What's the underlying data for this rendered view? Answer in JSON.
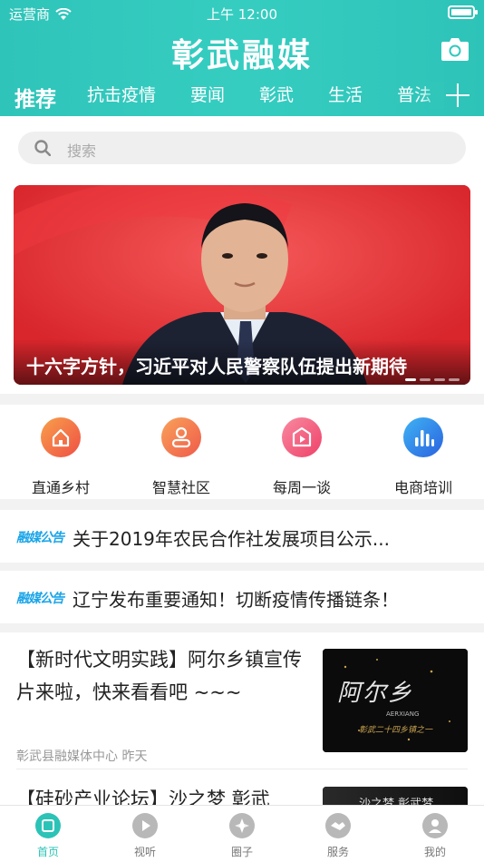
{
  "status": {
    "carrier": "运营商",
    "time": "上午 12:00"
  },
  "header": {
    "title": "彰武融媒"
  },
  "tabs": [
    {
      "label": "推荐"
    },
    {
      "label": "抗击疫情"
    },
    {
      "label": "要闻"
    },
    {
      "label": "彰武"
    },
    {
      "label": "生活"
    },
    {
      "label": "普法"
    }
  ],
  "search": {
    "placeholder": "搜索"
  },
  "banner": {
    "caption": "十六字方针，习近平对人民警察队伍提出新期待",
    "slide_count": 4,
    "active_slide": 1
  },
  "quick_links": [
    {
      "label": "直通乡村",
      "icon": "home-icon",
      "color": "#f06a46"
    },
    {
      "label": "智慧社区",
      "icon": "person-icon",
      "color": "#f27b4e"
    },
    {
      "label": "每周一谈",
      "icon": "play-icon",
      "color": "#f45d7c"
    },
    {
      "label": "电商培训",
      "icon": "bar-chart-icon",
      "color": "#2e7de8"
    }
  ],
  "notice_tag": "融媒公告",
  "notices": [
    {
      "text": "关于2019年农民合作社发展项目公示..."
    },
    {
      "text": "辽宁发布重要通知！切断疫情传播链条！"
    }
  ],
  "articles": [
    {
      "title": "【新时代文明实践】阿尔乡镇宣传片来啦，快来看看吧 ~~~",
      "source": "彰武县融媒体中心",
      "time": "昨天",
      "thumb_title": "阿尔乡",
      "thumb_sub": "AERXIANG",
      "thumb_tag": "彰武二十四乡镇之一"
    },
    {
      "title": "【硅砂产业论坛】沙之梦 彰武",
      "thumb_title": "沙之梦 彰武梦"
    }
  ],
  "tabbar": [
    {
      "label": "首页",
      "icon": "home-icon"
    },
    {
      "label": "视听",
      "icon": "play-icon"
    },
    {
      "label": "圈子",
      "icon": "compass-icon"
    },
    {
      "label": "服务",
      "icon": "handshake-icon"
    },
    {
      "label": "我的",
      "icon": "user-icon"
    }
  ],
  "colors": {
    "brand": "#2fc4b9",
    "notice_tag": "#1aa5e8",
    "banner_red": "#e42e33"
  }
}
